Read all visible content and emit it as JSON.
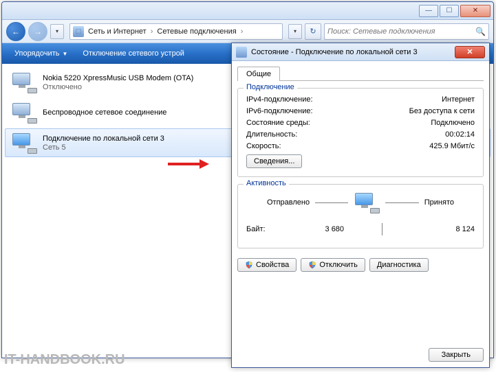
{
  "window": {
    "minimize": "—",
    "maximize": "☐",
    "close": "✕"
  },
  "nav": {
    "back": "←",
    "forward": "→",
    "refresh": "↻",
    "dropdown": "▾"
  },
  "breadcrumb": {
    "item1": "Сеть и Интернет",
    "item2": "Сетевые подключения",
    "sep": "›"
  },
  "search": {
    "placeholder": "Поиск: Сетевые подключения",
    "icon": "🔍"
  },
  "toolbar": {
    "organize": "Упорядочить",
    "disable": "Отключение сетевого устрой",
    "help": "?"
  },
  "connections": [
    {
      "name": "Nokia 5220 XpressMusic USB Modem (OTA)",
      "status": "Отключено"
    },
    {
      "name": "Беспроводное сетевое соединение",
      "status": ""
    },
    {
      "name": "Подключение по локальной сети 3",
      "status": "Сеть 5"
    }
  ],
  "dialog": {
    "title": "Состояние - Подключение по локальной сети 3",
    "close": "✕",
    "tab": "Общие",
    "connection": {
      "legend": "Подключение",
      "rows": [
        {
          "label": "IPv4-подключение:",
          "value": "Интернет"
        },
        {
          "label": "IPv6-подключение:",
          "value": "Без доступа к сети"
        },
        {
          "label": "Состояние среды:",
          "value": "Подключено"
        },
        {
          "label": "Длительность:",
          "value": "00:02:14"
        },
        {
          "label": "Скорость:",
          "value": "425.9 Мбит/с"
        }
      ],
      "details_btn": "Сведения..."
    },
    "activity": {
      "legend": "Активность",
      "sent": "Отправлено",
      "received": "Принято",
      "bytes_label": "Байт:",
      "bytes_sent": "3 680",
      "bytes_received": "8 124"
    },
    "buttons": {
      "properties": "Свойства",
      "disable": "Отключить",
      "diagnose": "Диагностика",
      "close": "Закрыть"
    }
  },
  "watermark": "IT-HANDBOOK.RU"
}
